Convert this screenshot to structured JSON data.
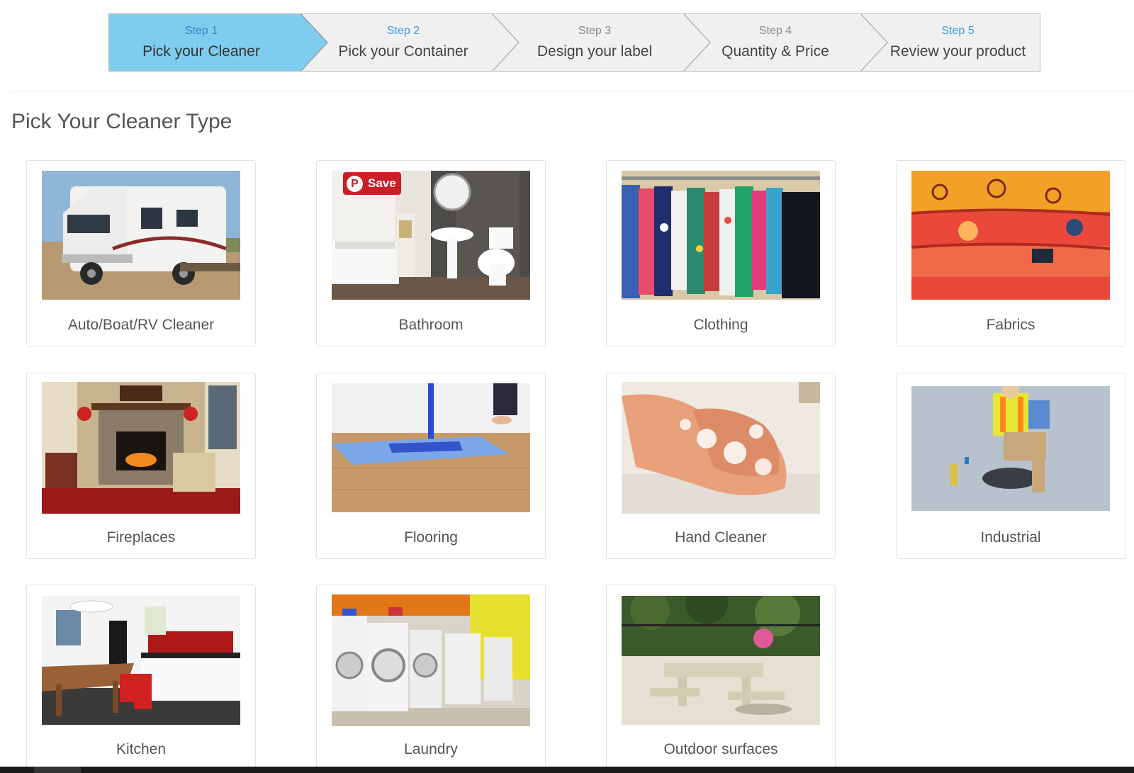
{
  "wizard": {
    "steps": [
      {
        "num": "Step 1",
        "label": "Pick your Cleaner",
        "active": true
      },
      {
        "num": "Step 2",
        "label": "Pick your Container"
      },
      {
        "num": "Step 3",
        "label": "Design your label"
      },
      {
        "num": "Step 4",
        "label": "Quantity & Price"
      },
      {
        "num": "Step 5",
        "label": "Review your product"
      }
    ]
  },
  "page": {
    "title": "Pick Your Cleaner Type"
  },
  "pinterest": {
    "save_label": "Save",
    "icon": "pinterest-icon"
  },
  "cleaners": [
    {
      "label": "Auto/Boat/RV Cleaner",
      "image": "rv-photo"
    },
    {
      "label": "Bathroom",
      "image": "bathroom-photo"
    },
    {
      "label": "Clothing",
      "image": "clothing-rack-photo"
    },
    {
      "label": "Fabrics",
      "image": "fabrics-photo"
    },
    {
      "label": "Fireplaces",
      "image": "fireplace-photo"
    },
    {
      "label": "Flooring",
      "image": "mop-floor-photo"
    },
    {
      "label": "Hand Cleaner",
      "image": "hand-washing-photo"
    },
    {
      "label": "Industrial",
      "image": "industrial-worker-photo"
    },
    {
      "label": "Kitchen",
      "image": "kitchen-photo"
    },
    {
      "label": "Laundry",
      "image": "laundry-machines-photo"
    },
    {
      "label": "Outdoor surfaces",
      "image": "outdoor-patio-photo"
    }
  ],
  "colors": {
    "active_step": "#7fcdee",
    "step_num_blue": "#3a9ad9",
    "pinterest_red": "#cb1f27"
  }
}
